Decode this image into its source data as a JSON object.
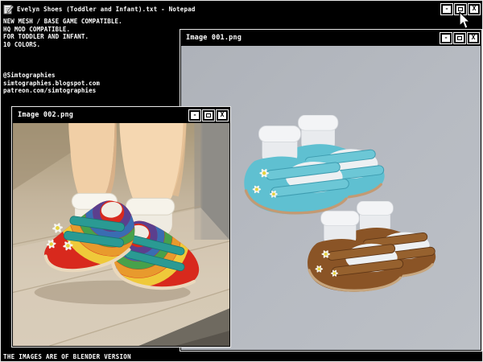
{
  "main_window": {
    "title": "Evelyn Shoes (Toddler and Infant).txt - Notepad",
    "body_text": "NEW MESH / BASE GAME COMPATIBLE.\nHQ MOD COMPATIBLE.\nFOR TODDLER AND INFANT.\n10 COLORS.\n\n\n\n@Simtographies\nsimtographies.blogspot.com\npatreon.com/simtographies",
    "footer_text": "THE IMAGES ARE OF BLENDER VERSION",
    "controls": {
      "minimize_label": "-",
      "close_label": "X"
    }
  },
  "image_window_1": {
    "title": "Image 001.png"
  },
  "image_window_2": {
    "title": "Image 002.png"
  },
  "colors": {
    "window_bg": "#000000",
    "titlebar_text": "#ffffff",
    "render_background": "#b7bbc2",
    "photo_background": "#c9bba3",
    "shoe_teal": "#5fc0d1",
    "shoe_brown": "#8a5426",
    "shoe_red": "#d8291d",
    "strap_teal": "#2a9a93",
    "rainbow_bands": [
      "#efc93a",
      "#e89a2d",
      "#47a14b",
      "#3a6cb2",
      "#5b3f8e"
    ],
    "daisy_petal": "#f5f5f0",
    "daisy_center": "#e6d23e",
    "sock_white": "#f1ede3"
  }
}
